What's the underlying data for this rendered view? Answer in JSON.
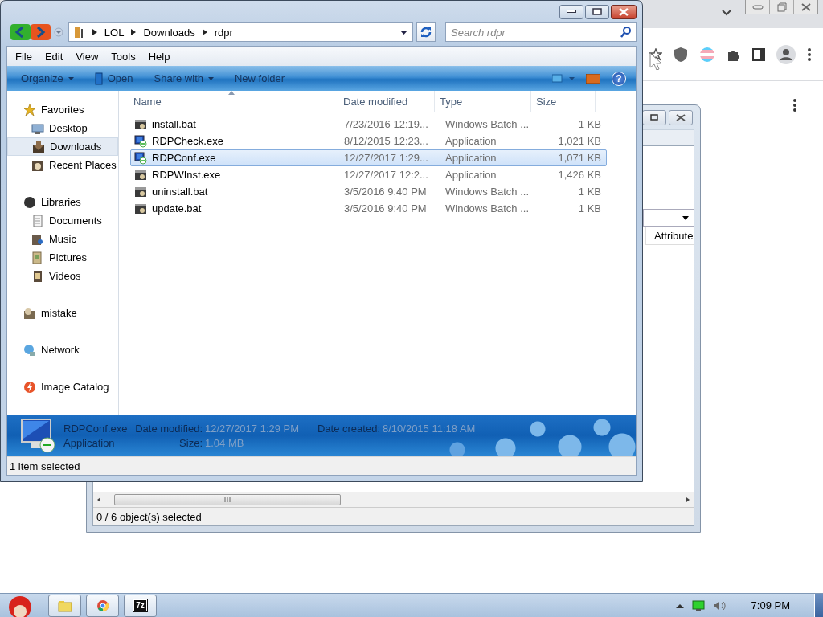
{
  "explorer": {
    "breadcrumbs": [
      "LOL",
      "Downloads",
      "rdpr"
    ],
    "search": {
      "placeholder": "Search rdpr"
    },
    "menu": [
      "File",
      "Edit",
      "View",
      "Tools",
      "Help"
    ],
    "toolbar": [
      {
        "label": "Organize",
        "kind": "dropdown"
      },
      {
        "label": "Open",
        "kind": "open"
      },
      {
        "label": "Share with",
        "kind": "dropdown"
      },
      {
        "label": "New folder",
        "kind": "plain"
      }
    ],
    "help_button": "?",
    "sidebar": [
      {
        "label": "Favorites",
        "kind": "star",
        "selected": false,
        "children": [
          {
            "label": "Desktop",
            "kind": "desktop",
            "selected": false
          },
          {
            "label": "Downloads",
            "kind": "download",
            "selected": true
          },
          {
            "label": "Recent Places",
            "kind": "recent",
            "selected": false
          }
        ]
      },
      {
        "label": "Libraries",
        "kind": "library",
        "selected": false,
        "children": [
          {
            "label": "Documents",
            "kind": "document",
            "selected": false
          },
          {
            "label": "Music",
            "kind": "music",
            "selected": false
          },
          {
            "label": "Pictures",
            "kind": "picture",
            "selected": false
          },
          {
            "label": "Videos",
            "kind": "video",
            "selected": false
          }
        ]
      },
      {
        "label": "mistake",
        "kind": "user",
        "selected": false
      },
      {
        "label": "Network",
        "kind": "network",
        "selected": false
      },
      {
        "label": "Image Catalog",
        "kind": "catalog",
        "selected": false
      }
    ],
    "columns": [
      "Name",
      "Date modified",
      "Type",
      "Size"
    ],
    "rows": [
      {
        "name": "install.bat",
        "date": "7/23/2016 12:19...",
        "type": "Windows Batch ...",
        "size": "1 KB",
        "kind": "batch",
        "selected": false
      },
      {
        "name": "RDPCheck.exe",
        "date": "8/12/2015 12:23...",
        "type": "Application",
        "size": "1,021 KB",
        "kind": "remote",
        "selected": false
      },
      {
        "name": "RDPConf.exe",
        "date": "12/27/2017 1:29...",
        "type": "Application",
        "size": "1,071 KB",
        "kind": "remote",
        "selected": true
      },
      {
        "name": "RDPWInst.exe",
        "date": "12/27/2017 12:2...",
        "type": "Application",
        "size": "1,426 KB",
        "kind": "batch",
        "selected": false
      },
      {
        "name": "uninstall.bat",
        "date": "3/5/2016 9:40 PM",
        "type": "Windows Batch ...",
        "size": "1 KB",
        "kind": "batch",
        "selected": false
      },
      {
        "name": "update.bat",
        "date": "3/5/2016 9:40 PM",
        "type": "Windows Batch ...",
        "size": "1 KB",
        "kind": "batch",
        "selected": false
      }
    ],
    "details": {
      "name": "RDPConf.exe",
      "type": "Application",
      "fields": [
        {
          "label": "Date modified:",
          "value": "12/27/2017 1:29 PM"
        },
        {
          "label": "Date created:",
          "value": "8/10/2015 11:18 AM"
        },
        {
          "label": "Size:",
          "value": "1.04 MB"
        }
      ]
    },
    "status": "1 item selected"
  },
  "back_window": {
    "column_header": "Attribute",
    "status": "0 / 6 object(s) selected"
  },
  "taskbar": {
    "apps": [
      {
        "kind": "explorer"
      },
      {
        "kind": "chrome"
      },
      {
        "kind": "archiver",
        "label": "7z"
      }
    ],
    "clock": "7:09 PM"
  }
}
